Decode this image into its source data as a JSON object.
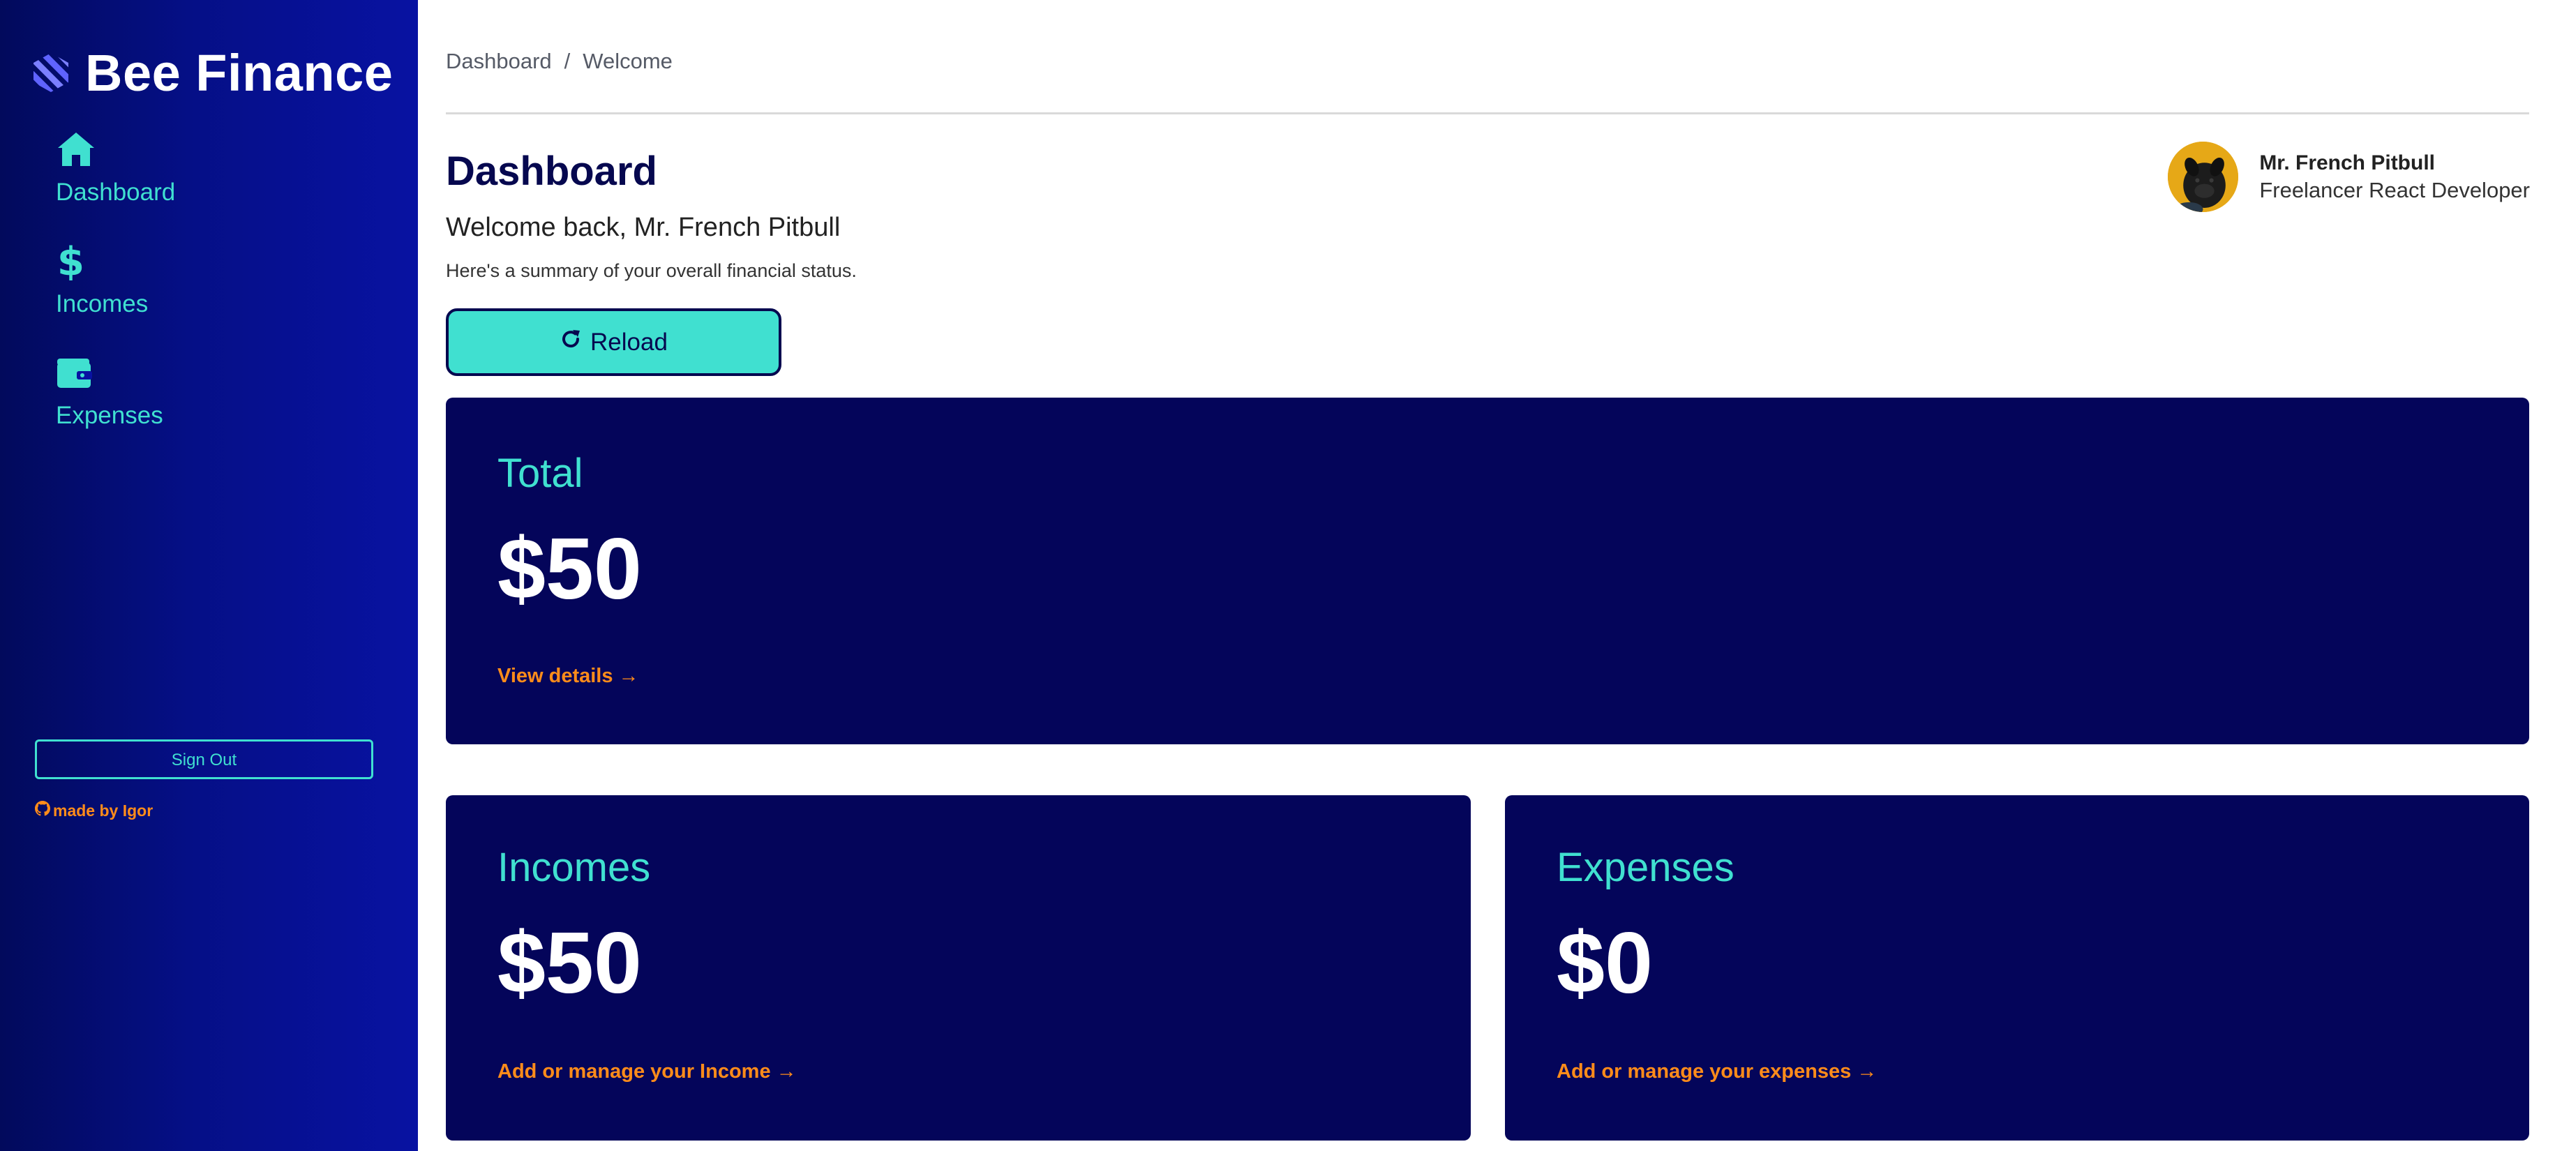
{
  "app": {
    "name": "Bee Finance",
    "logo_icon": "bee-stripes-logo"
  },
  "sidebar": {
    "items": [
      {
        "label": "Dashboard",
        "icon": "home-icon"
      },
      {
        "label": "Incomes",
        "icon": "dollar-icon"
      },
      {
        "label": "Expenses",
        "icon": "wallet-icon"
      }
    ],
    "sign_out_label": "Sign Out",
    "made_by_label": "made by Igor",
    "made_by_icon": "github-icon"
  },
  "breadcrumb": {
    "items": [
      "Dashboard",
      "Welcome"
    ],
    "separator": "/"
  },
  "header": {
    "title": "Dashboard",
    "welcome": "Welcome back, Mr. French Pitbull",
    "summary": "Here's a summary of your overall financial status.",
    "reload_label": "Reload",
    "reload_icon": "refresh-icon"
  },
  "profile": {
    "name": "Mr. French Pitbull",
    "role": "Freelancer React Developer",
    "avatar_bg": "#e6a817"
  },
  "cards": {
    "total": {
      "title": "Total",
      "value": "$50",
      "link": "View details",
      "link_arrow": "→"
    },
    "incomes": {
      "title": "Incomes",
      "value": "$50",
      "link": "Add or manage your Income",
      "link_arrow": "→"
    },
    "expenses": {
      "title": "Expenses",
      "value": "$0",
      "link": "Add or manage your expenses",
      "link_arrow": "→"
    }
  },
  "colors": {
    "accent": "#40e0d0",
    "card_bg": "#04055a",
    "link": "#ff8c1a",
    "title": "#06084f",
    "sidebar_dark": "#020a5c",
    "sidebar_light": "#0812a2"
  }
}
